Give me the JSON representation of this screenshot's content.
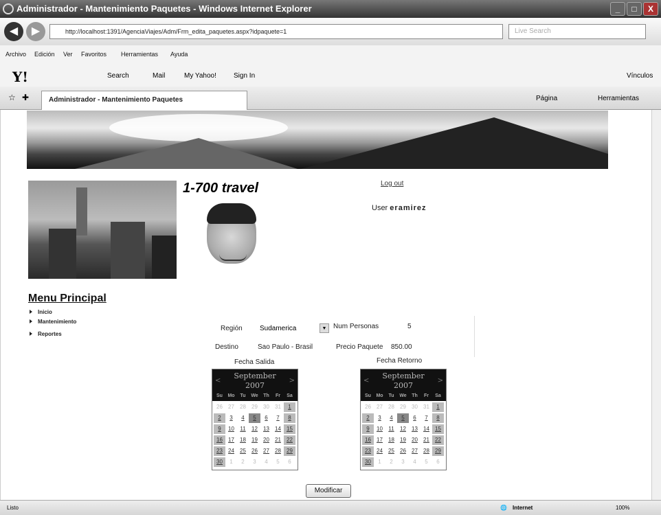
{
  "window": {
    "title": "Administrador - Mantenimiento Paquetes - Windows Internet Explorer",
    "controls": [
      "_",
      "□",
      "X"
    ]
  },
  "browser": {
    "address": "http://localhost:1391/AgenciaViajes/Adm/Frm_edita_paquetes.aspx?idpaquete=1",
    "search_placeholder": "Live Search",
    "menu": [
      "Archivo",
      "Edición",
      "Ver",
      "Favoritos",
      "Herramientas",
      "Ayuda"
    ],
    "yahoo_toolbar": {
      "search": "Search",
      "mail": "Mail",
      "myyahoo": "My Yahoo!",
      "signin": "Sign In",
      "right": "Vínculos"
    },
    "tab_label": "Administrador - Mantenimiento Paquetes",
    "tab_tools": {
      "page": "Página",
      "tools": "Herramientas"
    }
  },
  "site": {
    "logo": "1-700 travel",
    "logout": "Log out",
    "user_label": "User",
    "user_name": "eramirez"
  },
  "menu": {
    "title": "Menu Principal",
    "items": [
      "Inicio",
      "Mantenimiento",
      "Reportes"
    ]
  },
  "form": {
    "region_label": "Región",
    "region_value": "Sudamerica",
    "num_personas_label": "Num Personas",
    "num_personas_value": "5",
    "destino_label": "Destino",
    "destino_value": "Sao Paulo - Brasil",
    "precio_label": "Precio Paquete",
    "precio_value": "850.00",
    "fecha_salida_label": "Fecha Salida",
    "fecha_retorno_label": "Fecha Retorno",
    "submit_label": "Modificar"
  },
  "calendar": {
    "month": "September",
    "year": "2007",
    "prev": "<",
    "next": ">",
    "weekdays": [
      "Su",
      "Mo",
      "Tu",
      "We",
      "Th",
      "Fr",
      "Sa"
    ],
    "weeks": [
      [
        "26",
        "27",
        "28",
        "29",
        "30",
        "31",
        "1"
      ],
      [
        "2",
        "3",
        "4",
        "5",
        "6",
        "7",
        "8"
      ],
      [
        "9",
        "10",
        "11",
        "12",
        "13",
        "14",
        "15"
      ],
      [
        "16",
        "17",
        "18",
        "19",
        "20",
        "21",
        "22"
      ],
      [
        "23",
        "24",
        "25",
        "26",
        "27",
        "28",
        "29"
      ],
      [
        "30",
        "1",
        "2",
        "3",
        "4",
        "5",
        "6"
      ]
    ]
  },
  "status": {
    "left": "Listo",
    "zone": "Internet",
    "zoom": "100%"
  }
}
